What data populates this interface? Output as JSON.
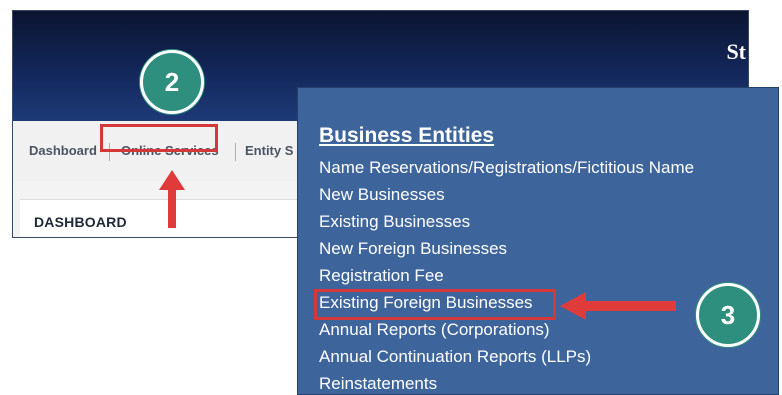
{
  "app": {
    "brand_partial": "St",
    "nav": [
      "Dashboard",
      "Online Services",
      "Entity S"
    ],
    "dashboard_title": "DASHBOARD"
  },
  "menu": {
    "title": "Business Entities",
    "items": [
      "Name Reservations/Registrations/Fictitious Name",
      "New Businesses",
      "Existing Businesses",
      "New Foreign Businesses",
      "Registration Fee",
      "Existing Foreign Businesses",
      "Annual Reports (Corporations)",
      "Annual Continuation Reports (LLPs)",
      "Reinstatements"
    ]
  },
  "callouts": {
    "step_2": "2",
    "step_3": "3"
  },
  "colors": {
    "header_dark": "#0b1430",
    "menu_bg": "#3e659b",
    "highlight": "#d43838",
    "badge": "#2f8f7e"
  }
}
